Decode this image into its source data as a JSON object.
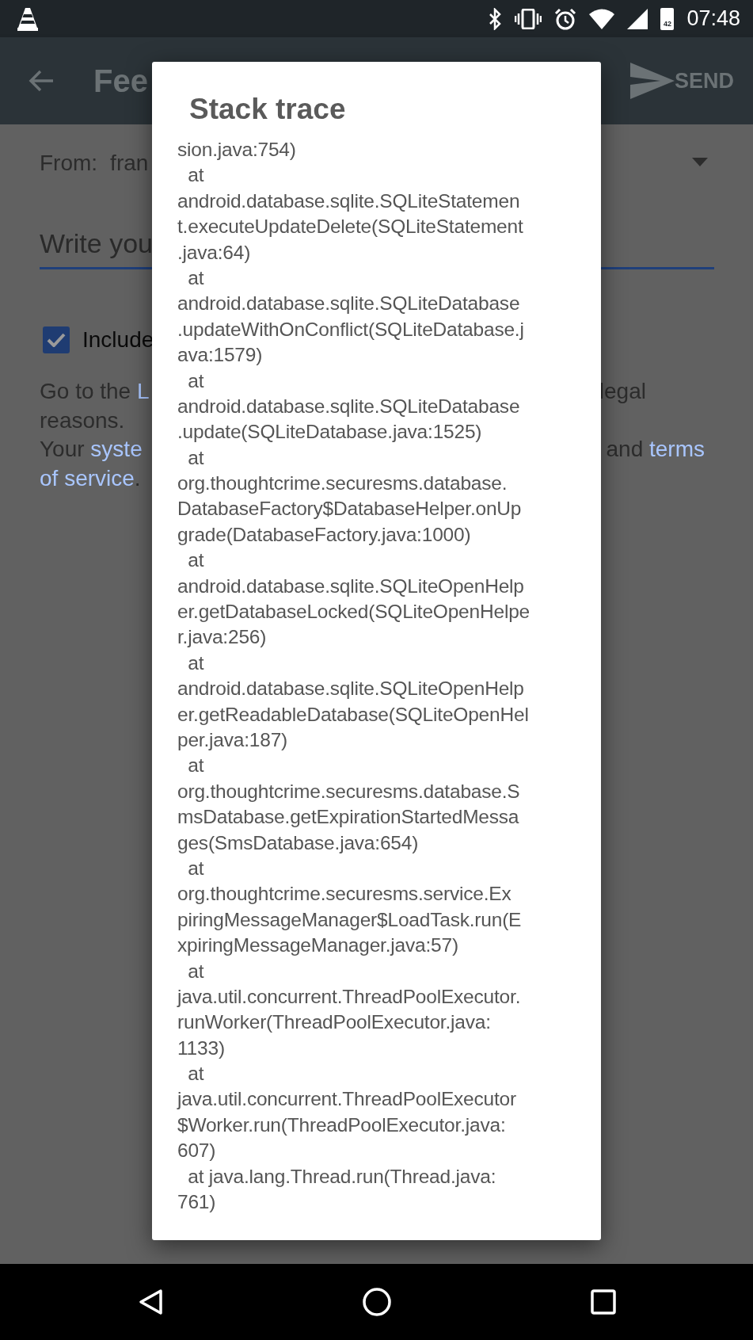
{
  "status_bar": {
    "battery_text": "42",
    "time": "07:48"
  },
  "app_bar": {
    "title": "Fee",
    "action": "SEND"
  },
  "form": {
    "from_label": "From:",
    "from_value": "fran",
    "message_placeholder": "Write you",
    "include_checkbox": {
      "label": "Include",
      "checked": true
    },
    "notice_lines": [
      {
        "left": [
          {
            "text": "Go to the ",
            "link": false
          },
          {
            "text": "L",
            "link": true
          }
        ],
        "right": [
          {
            "text": "legal",
            "link": false
          }
        ]
      },
      {
        "left": [
          {
            "text": "reasons.",
            "link": false
          }
        ]
      },
      {
        "left": [
          {
            "text": "Your ",
            "link": false
          },
          {
            "text": "syste",
            "link": true
          }
        ],
        "right": [
          {
            "text": "and ",
            "link": false
          },
          {
            "text": "terms",
            "link": true
          }
        ]
      },
      {
        "left": [
          {
            "text": "of service",
            "link": true
          },
          {
            "text": ".",
            "link": false
          }
        ]
      }
    ]
  },
  "dialog": {
    "title": "Stack trace",
    "lines": [
      "sion.java:754)",
      "  at",
      "android.database.sqlite.SQLiteStatemen",
      "t.executeUpdateDelete(SQLiteStatement",
      ".java:64)",
      "  at",
      "android.database.sqlite.SQLiteDatabase",
      ".updateWithOnConflict(SQLiteDatabase.j",
      "ava:1579)",
      "  at",
      "android.database.sqlite.SQLiteDatabase",
      ".update(SQLiteDatabase.java:1525)",
      "  at",
      "org.thoughtcrime.securesms.database.",
      "DatabaseFactory$DatabaseHelper.onUp",
      "grade(DatabaseFactory.java:1000)",
      "  at",
      "android.database.sqlite.SQLiteOpenHelp",
      "er.getDatabaseLocked(SQLiteOpenHelpe",
      "r.java:256)",
      "  at",
      "android.database.sqlite.SQLiteOpenHelp",
      "er.getReadableDatabase(SQLiteOpenHel",
      "per.java:187)",
      "  at",
      "org.thoughtcrime.securesms.database.S",
      "msDatabase.getExpirationStartedMessa",
      "ges(SmsDatabase.java:654)",
      "  at",
      "org.thoughtcrime.securesms.service.Ex",
      "piringMessageManager$LoadTask.run(E",
      "xpiringMessageManager.java:57)",
      "  at",
      "java.util.concurrent.ThreadPoolExecutor.",
      "runWorker(ThreadPoolExecutor.java:",
      "1133)",
      "  at",
      "java.util.concurrent.ThreadPoolExecutor",
      "$Worker.run(ThreadPoolExecutor.java:",
      "607)",
      "  at java.lang.Thread.run(Thread.java:",
      "761)"
    ]
  }
}
